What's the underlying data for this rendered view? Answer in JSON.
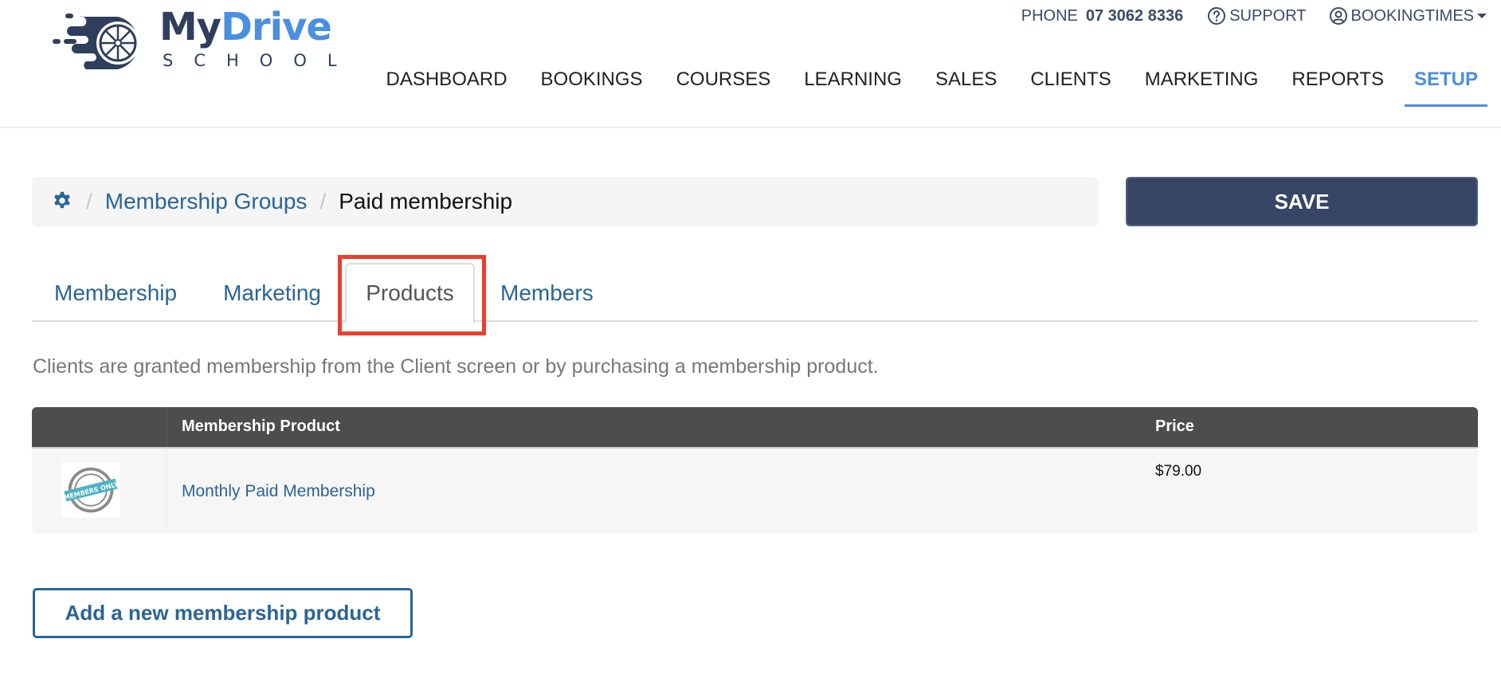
{
  "brand": {
    "name_part1": "My",
    "name_part2": "Drive",
    "subtitle": "SCHOOL",
    "colors": {
      "dark": "#2f3e5c",
      "accent": "#4a8fe0"
    }
  },
  "toplinks": {
    "phone_label": "PHONE",
    "phone_number": "07 3062 8336",
    "support_label": "SUPPORT",
    "support_icon": "question-circle-icon",
    "account_label": "BOOKINGTIMES",
    "account_icon": "user-circle-icon"
  },
  "nav": {
    "items": [
      {
        "label": "DASHBOARD",
        "active": false
      },
      {
        "label": "BOOKINGS",
        "active": false
      },
      {
        "label": "COURSES",
        "active": false
      },
      {
        "label": "LEARNING",
        "active": false
      },
      {
        "label": "SALES",
        "active": false
      },
      {
        "label": "CLIENTS",
        "active": false
      },
      {
        "label": "MARKETING",
        "active": false
      },
      {
        "label": "REPORTS",
        "active": false
      },
      {
        "label": "SETUP",
        "active": true
      }
    ]
  },
  "breadcrumb": {
    "home_icon": "gear-icon",
    "separator": "/",
    "parent": "Membership Groups",
    "current": "Paid membership"
  },
  "actions": {
    "save_label": "SAVE",
    "save_color": "#364566"
  },
  "tabs": {
    "items": [
      {
        "label": "Membership",
        "active": false
      },
      {
        "label": "Marketing",
        "active": false
      },
      {
        "label": "Products",
        "active": true
      },
      {
        "label": "Members",
        "active": false
      }
    ],
    "highlight_color": "#e8402b"
  },
  "description": "Clients are granted membership from the Client screen or by purchasing a membership product.",
  "products_table": {
    "columns": [
      "",
      "Membership Product",
      "Price"
    ],
    "rows": [
      {
        "image_alt": "Members Only badge",
        "badge_text": "MEMBERS ONLY",
        "name": "Monthly Paid Membership",
        "price": "$79.00"
      }
    ]
  },
  "add_button_label": "Add a new membership product"
}
